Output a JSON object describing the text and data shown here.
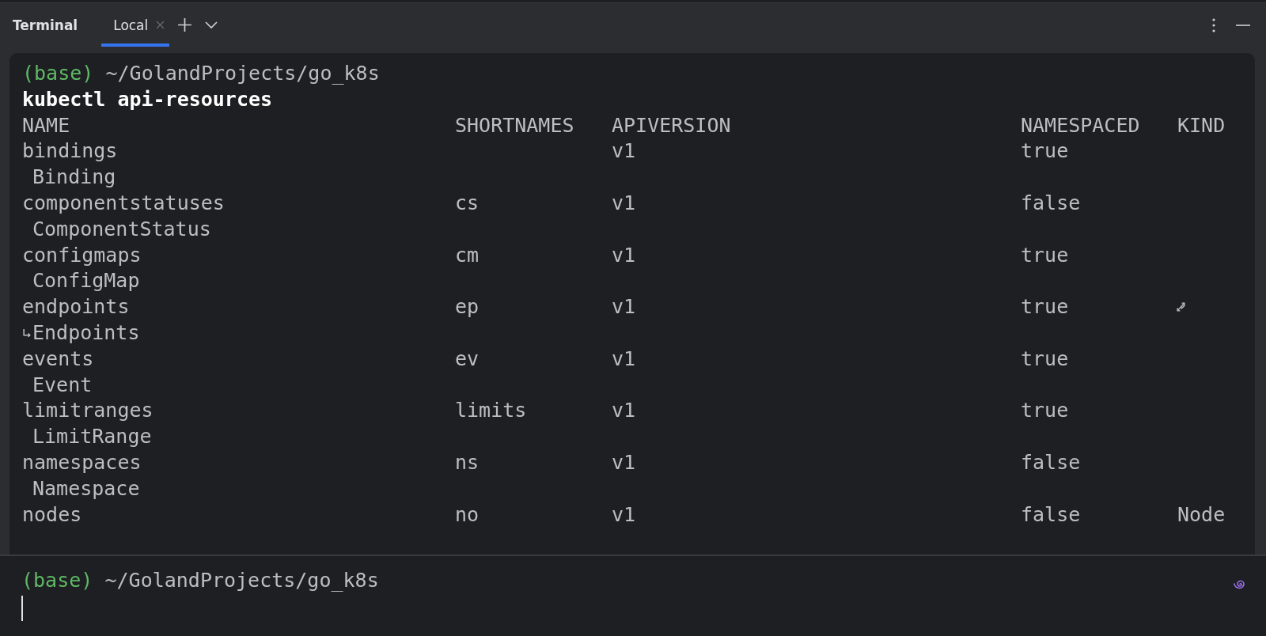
{
  "toolbar": {
    "title": "Terminal",
    "tabs": [
      {
        "label": "Local",
        "selected": true
      }
    ]
  },
  "session": {
    "prompt_env": "(base)",
    "prompt_path": "~/GolandProjects/go_k8s",
    "command": "kubectl api-resources",
    "header": [
      "NAME",
      "SHORTNAMES",
      "APIVERSION",
      "NAMESPACED",
      "KIND"
    ],
    "rows": [
      {
        "name": "bindings",
        "apiversion": "v1",
        "namespaced": "true",
        "continuation": "Binding",
        "wrap_marker": false
      },
      {
        "name": "componentstatuses",
        "shortnames": "cs",
        "apiversion": "v1",
        "namespaced": "false",
        "continuation": "ComponentStatus",
        "wrap_marker": false
      },
      {
        "name": "configmaps",
        "shortnames": "cm",
        "apiversion": "v1",
        "namespaced": "true",
        "continuation": "ConfigMap",
        "wrap_marker": false
      },
      {
        "name": "endpoints",
        "shortnames": "ep",
        "apiversion": "v1",
        "namespaced": "true",
        "continuation": "Endpoints",
        "wrap_marker": true
      },
      {
        "name": "events",
        "shortnames": "ev",
        "apiversion": "v1",
        "namespaced": "true",
        "continuation": "Event",
        "wrap_marker": false
      },
      {
        "name": "limitranges",
        "shortnames": "limits",
        "apiversion": "v1",
        "namespaced": "true",
        "continuation": "LimitRange",
        "wrap_marker": false
      },
      {
        "name": "namespaces",
        "shortnames": "ns",
        "apiversion": "v1",
        "namespaced": "false",
        "continuation": "Namespace",
        "wrap_marker": false
      },
      {
        "name": "nodes",
        "shortnames": "no",
        "apiversion": "v1",
        "namespaced": "false",
        "kind_value": "Node",
        "wrap_marker": false
      }
    ]
  },
  "prompt": {
    "env": "(base)",
    "path": "~/GolandProjects/go_k8s"
  }
}
